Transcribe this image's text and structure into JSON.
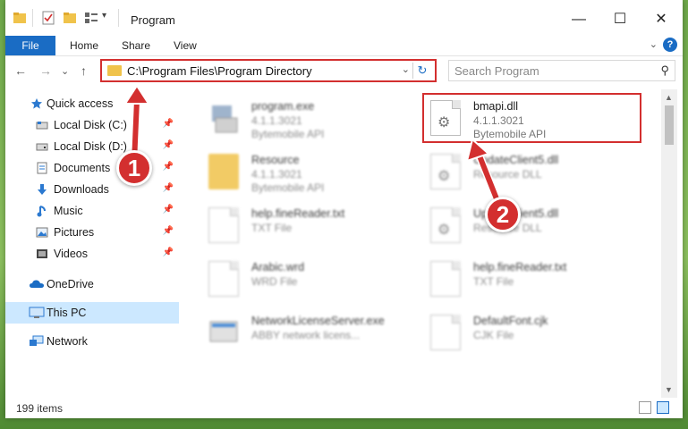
{
  "window": {
    "title": "Program",
    "minimize": "—",
    "maximize": "☐",
    "close": "✕"
  },
  "ribbon": {
    "file": "File",
    "home": "Home",
    "share": "Share",
    "view": "View",
    "help": "?",
    "expand": "⌄"
  },
  "nav": {
    "back": "←",
    "forward": "→",
    "recent": "⌄",
    "up": "↑",
    "address": "C:\\Program Files\\Program Directory",
    "address_dropdown": "⌄",
    "refresh": "↻",
    "search_placeholder": "Search Program",
    "search_icon": "⚲"
  },
  "sidebar": {
    "items": [
      {
        "label": "Quick access",
        "icon": "star-icon"
      },
      {
        "label": "Local Disk (C:)",
        "icon": "drive-icon",
        "pinned": true
      },
      {
        "label": "Local Disk (D:)",
        "icon": "drive-icon",
        "pinned": true
      },
      {
        "label": "Documents",
        "icon": "documents-icon",
        "pinned": true
      },
      {
        "label": "Downloads",
        "icon": "download-icon",
        "pinned": true
      },
      {
        "label": "Music",
        "icon": "music-icon",
        "pinned": true
      },
      {
        "label": "Pictures",
        "icon": "pictures-icon",
        "pinned": true
      },
      {
        "label": "Videos",
        "icon": "videos-icon",
        "pinned": true
      },
      {
        "label": "OneDrive",
        "icon": "cloud-icon"
      },
      {
        "label": "This PC",
        "icon": "computer-icon",
        "selected": true
      },
      {
        "label": "Network",
        "icon": "network-icon"
      }
    ],
    "pin_glyph": "📌"
  },
  "files": [
    {
      "name": "program.exe",
      "line2": "4.1.1.3021",
      "line3": "Bytemobile API",
      "kind": "exe"
    },
    {
      "name": "bmapi.dll",
      "line2": "4.1.1.3021",
      "line3": "Bytemobile API",
      "kind": "dll"
    },
    {
      "name": "Resource",
      "line2": "4.1.1.3021",
      "line3": "Bytemobile API",
      "kind": "folder"
    },
    {
      "name": "UpdateClient5.dll",
      "line2": "Resource DLL",
      "line3": "",
      "kind": "dll"
    },
    {
      "name": "help.fineReader.txt",
      "line2": "TXT File",
      "line3": "",
      "kind": "txt"
    },
    {
      "name": "UpdateClient5.dll",
      "line2": "Resource DLL",
      "line3": "",
      "kind": "dll"
    },
    {
      "name": "Arabic.wrd",
      "line2": "WRD File",
      "line3": "",
      "kind": "txt"
    },
    {
      "name": "help.fineReader.txt",
      "line2": "TXT File",
      "line3": "",
      "kind": "txt"
    },
    {
      "name": "NetworkLicenseServer.exe",
      "line2": "ABBY network licens...",
      "line3": "",
      "kind": "exe"
    },
    {
      "name": "DefaultFont.cjk",
      "line2": "CJK File",
      "line3": "",
      "kind": "txt"
    }
  ],
  "status": {
    "items": "199 items"
  },
  "callouts": {
    "one": "1",
    "two": "2"
  },
  "colors": {
    "accent": "#1a6cc4",
    "highlight": "#d32f2f",
    "selection": "#cce8ff"
  }
}
